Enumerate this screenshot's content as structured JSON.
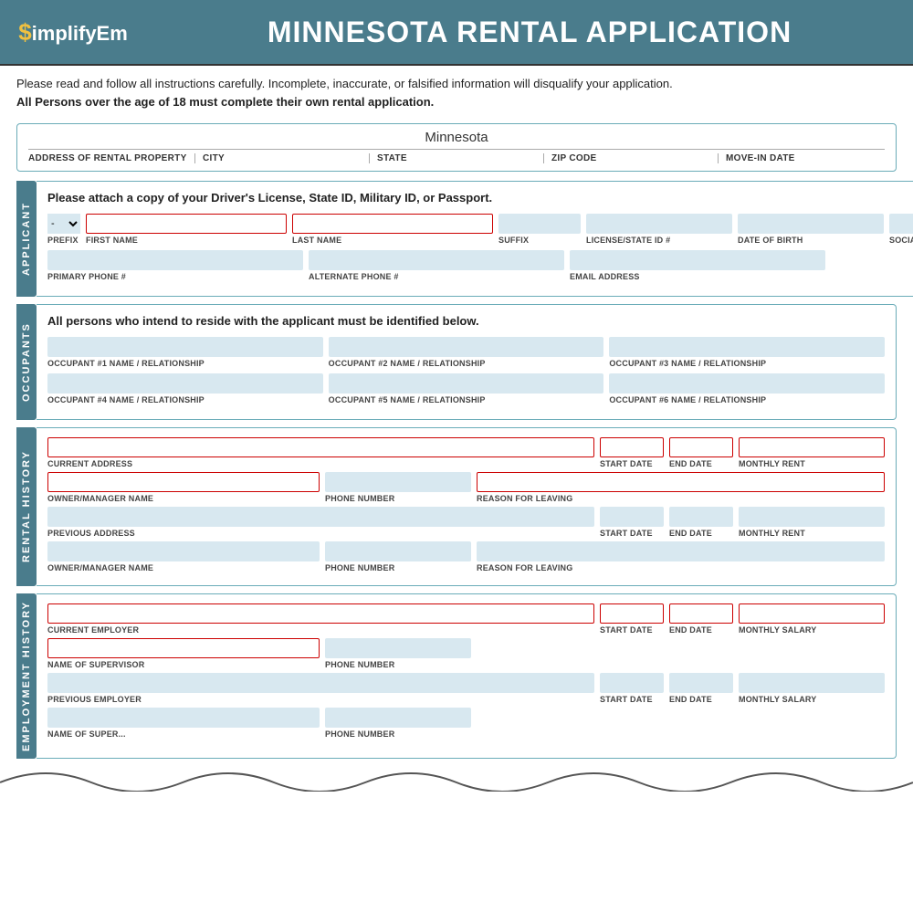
{
  "header": {
    "logo": "$implifyEm",
    "title": "MINNESOTA RENTAL APPLICATION"
  },
  "intro": {
    "line1": "Please read and follow all instructions carefully. Incomplete, inaccurate, or falsified information will disqualify your application.",
    "line2": "All Persons over the age of 18 must complete their own rental application."
  },
  "property": {
    "state": "Minnesota",
    "fields": [
      "ADDRESS OF RENTAL PROPERTY",
      "CITY",
      "STATE",
      "ZIP CODE",
      "MOVE-IN DATE"
    ]
  },
  "applicant": {
    "side_label": "APPLICANT",
    "attach_note": "Please attach a copy of your Driver's License, State ID, Military ID, or Passport.",
    "fields": {
      "prefix_label": "PREFIX",
      "first_name_label": "FIRST NAME",
      "last_name_label": "LAST NAME",
      "suffix_label": "SUFFIX",
      "license_label": "LICENSE/STATE ID #",
      "dob_label": "DATE OF BIRTH",
      "ssn_label": "SOCIAL SECURITY #",
      "primary_phone_label": "PRIMARY PHONE #",
      "alt_phone_label": "ALTERNATE PHONE #",
      "email_label": "EMAIL ADDRESS"
    }
  },
  "occupants": {
    "side_label": "OCCUPANTS",
    "note": "All persons who intend to reside with the applicant must be identified below.",
    "fields": [
      "OCCUPANT #1 NAME / RELATIONSHIP",
      "OCCUPANT #2 NAME / RELATIONSHIP",
      "OCCUPANT #3 NAME / RELATIONSHIP",
      "OCCUPANT #4 NAME / RELATIONSHIP",
      "OCCUPANT #5 NAME / RELATIONSHIP",
      "OCCUPANT #6 NAME / RELATIONSHIP"
    ]
  },
  "rental_history": {
    "side_label": "RENTAL HISTORY",
    "fields": {
      "current_address": "CURRENT ADDRESS",
      "start_date": "START DATE",
      "end_date": "END DATE",
      "monthly_rent": "MONTHLY RENT",
      "owner_manager": "OWNER/MANAGER NAME",
      "phone_number": "PHONE NUMBER",
      "reason_leaving": "REASON FOR LEAVING",
      "previous_address": "PREVIOUS ADDRESS",
      "prev_start_date": "START DATE",
      "prev_end_date": "END DATE",
      "prev_monthly_rent": "MONTHLY RENT",
      "prev_owner_manager": "OWNER/MANAGER NAME",
      "prev_phone_number": "PHONE NUMBER",
      "prev_reason_leaving": "REASON FOR LEAVING"
    }
  },
  "employment_history": {
    "side_label": "EMPLOYMENT HISTORY",
    "fields": {
      "current_employer": "CURRENT EMPLOYER",
      "start_date": "START DATE",
      "end_date": "END DATE",
      "monthly_salary": "MONTHLY SALARY",
      "supervisor_name": "NAME OF SUPERVISOR",
      "phone_number": "PHONE NUMBER",
      "previous_employer": "PREVIOUS EMPLOYER",
      "prev_start_date": "START DATE",
      "prev_end_date": "END DATE",
      "prev_monthly_salary": "MONTHLY SALARY",
      "prev_supervisor": "NAME OF SUPER...",
      "prev_phone": "PHONE NUMBER"
    }
  }
}
